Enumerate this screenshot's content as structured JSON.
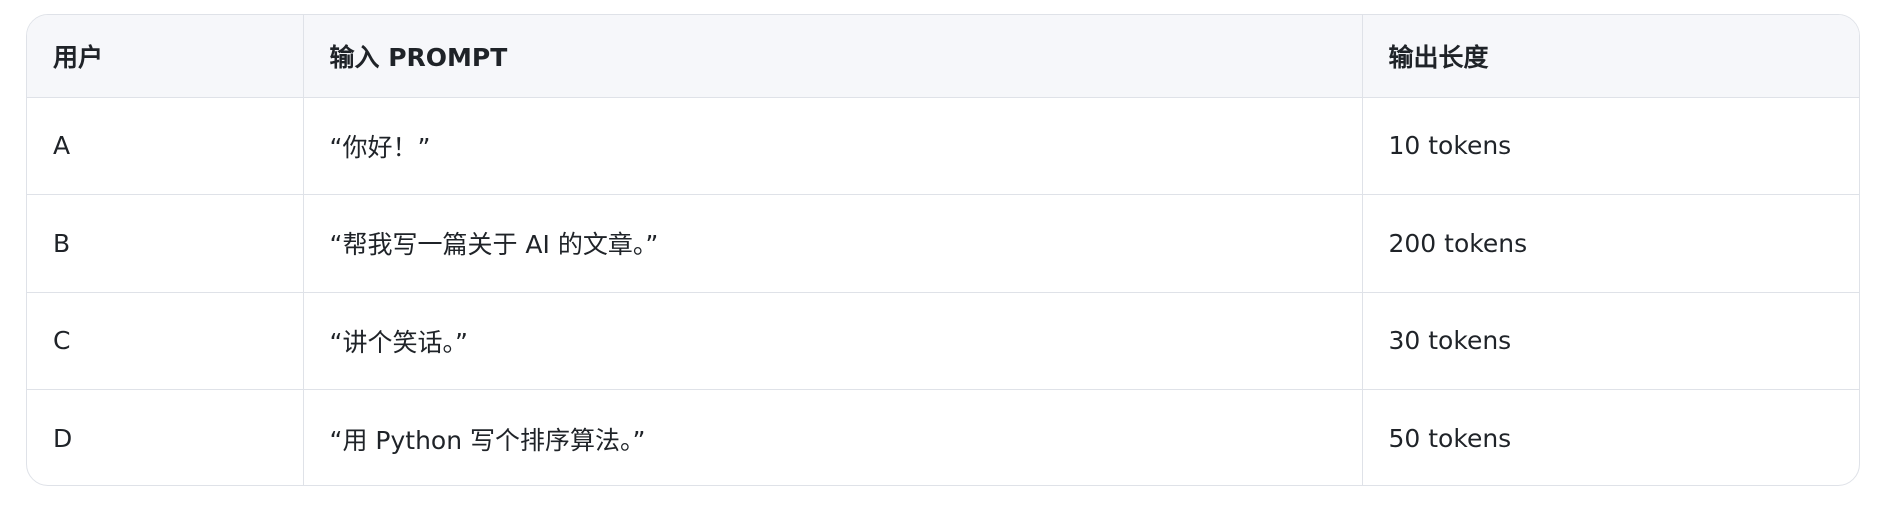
{
  "table": {
    "headers": [
      "用户",
      "输入 PROMPT",
      "输出长度"
    ],
    "rows": [
      {
        "user": "A",
        "prompt": "“你好！”",
        "output": "10 tokens"
      },
      {
        "user": "B",
        "prompt": "“帮我写一篇关于 AI 的文章。”",
        "output": "200 tokens"
      },
      {
        "user": "C",
        "prompt": "“讲个笑话。”",
        "output": "30 tokens"
      },
      {
        "user": "D",
        "prompt": "“用 Python 写个排序算法。”",
        "output": "50 tokens"
      }
    ]
  },
  "colors": {
    "header_background": "#f6f7fa",
    "border": "#dfe2e8",
    "text": "#1f2328"
  }
}
